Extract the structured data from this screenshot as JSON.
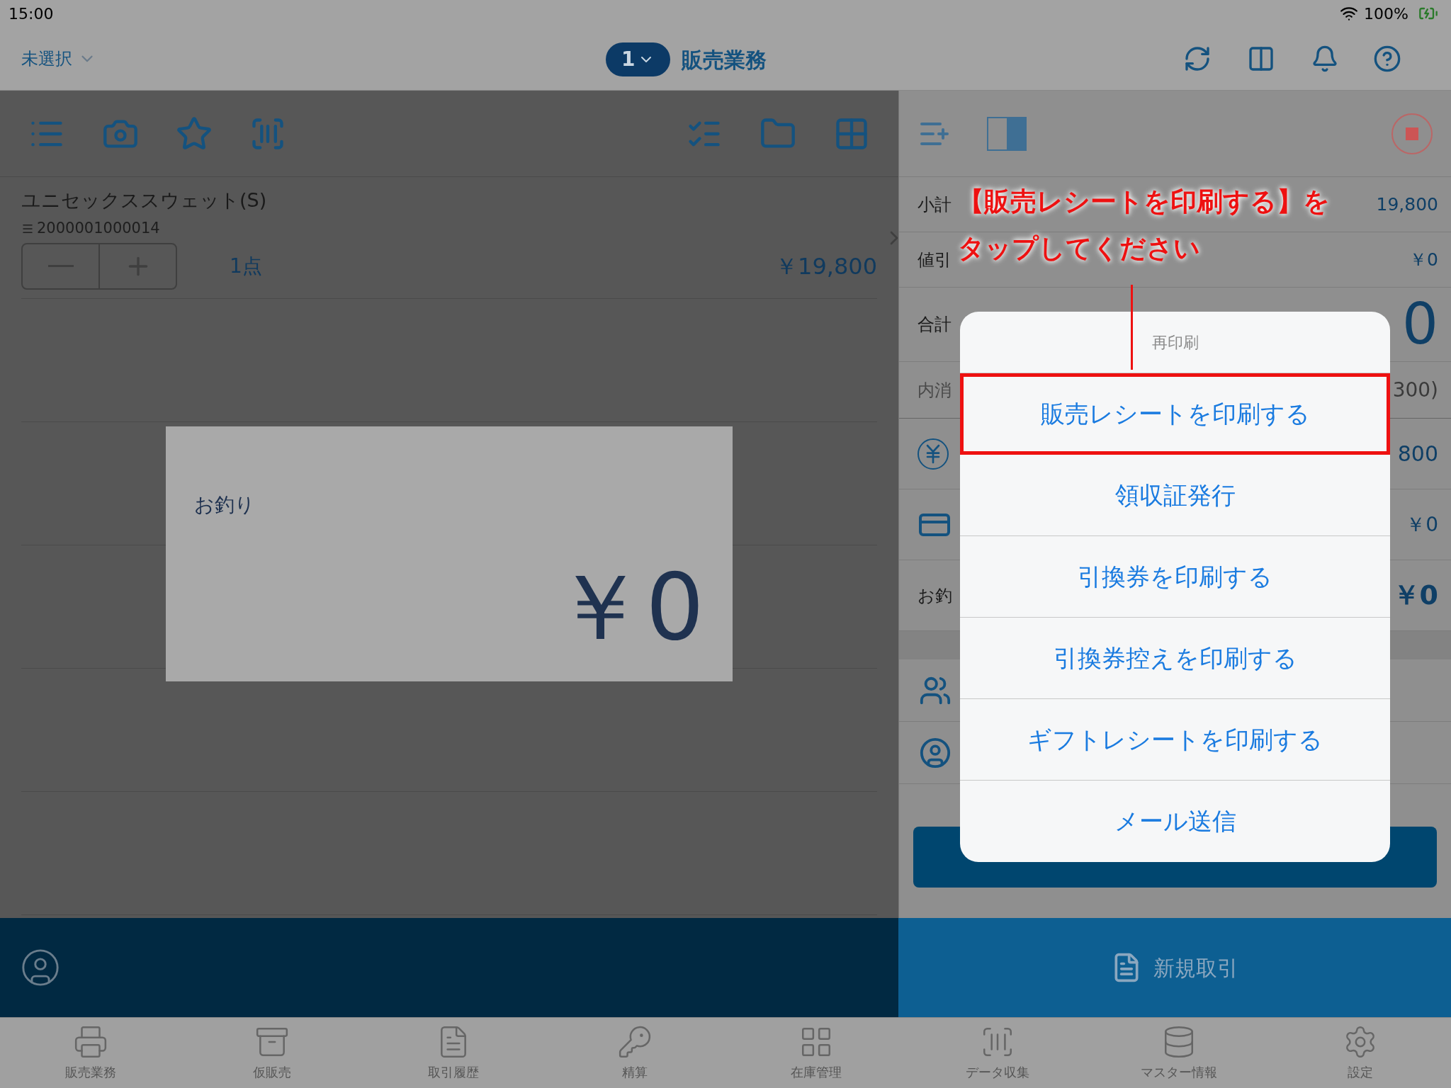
{
  "status_bar": {
    "time": "15:00",
    "battery": "100%"
  },
  "nav": {
    "store_selector": "未選択",
    "register_badge": "1",
    "title": "販売業務"
  },
  "cart_items": [
    {
      "name": "ユニセックススウェット(S)",
      "code": "2000001000014",
      "quantity": "1点",
      "price": "￥19,800"
    }
  ],
  "change_dialog": {
    "label": "お釣り",
    "amount": "￥0"
  },
  "summary_rows": [
    {
      "kind": "plain",
      "label": "小計",
      "value": "19,800"
    },
    {
      "kind": "plain",
      "label": "値引",
      "value": "￥0"
    },
    {
      "kind": "total",
      "label": "合計",
      "value": "0"
    },
    {
      "kind": "tax",
      "label": "内消",
      "value": "300)"
    },
    {
      "kind": "cash",
      "label": "",
      "value": "800"
    },
    {
      "kind": "card",
      "label": "",
      "value": "￥0"
    },
    {
      "kind": "change",
      "label": "お釣",
      "value": "￥0"
    }
  ],
  "action_sheet": {
    "title": "再印刷",
    "options": [
      {
        "label": "販売レシートを印刷する",
        "highlighted": true
      },
      {
        "label": "領収証発行",
        "highlighted": false
      },
      {
        "label": "引換券を印刷する",
        "highlighted": false
      },
      {
        "label": "引換券控えを印刷する",
        "highlighted": false
      },
      {
        "label": "ギフトレシートを印刷する",
        "highlighted": false
      },
      {
        "label": "メール送信",
        "highlighted": false
      }
    ]
  },
  "annotation": {
    "lines": [
      "【販売レシートを印刷する】を",
      "タップしてください"
    ]
  },
  "new_transaction_button": {
    "label": "新規取引"
  },
  "tabs": [
    {
      "label": "販売業務"
    },
    {
      "label": "仮販売"
    },
    {
      "label": "取引履歴"
    },
    {
      "label": "精算"
    },
    {
      "label": "在庫管理"
    },
    {
      "label": "データ収集"
    },
    {
      "label": "マスター情報"
    },
    {
      "label": "設定"
    }
  ]
}
